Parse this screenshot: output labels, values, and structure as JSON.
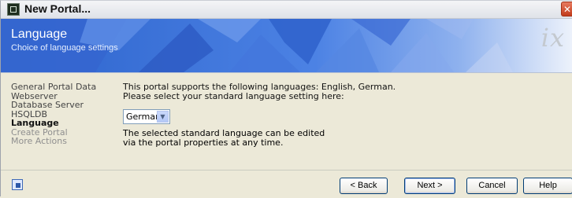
{
  "window": {
    "title": "New Portal...",
    "close_label": "✕"
  },
  "banner": {
    "title": "Language",
    "subtitle": "Choice of language settings",
    "logo": "ix"
  },
  "nav": {
    "items": [
      {
        "label": "General Portal Data",
        "state": "done"
      },
      {
        "label": "Webserver",
        "state": "done"
      },
      {
        "label": "Database Server",
        "state": "done"
      },
      {
        "label": "HSQLDB",
        "state": "done"
      },
      {
        "label": "Language",
        "state": "active"
      },
      {
        "label": "Create Portal",
        "state": "disabled"
      },
      {
        "label": "More Actions",
        "state": "disabled"
      }
    ]
  },
  "content": {
    "line1": "This portal supports the following languages: English, German.",
    "line2": "Please select your standard language setting here:",
    "language_select": {
      "value": "German"
    },
    "note1": "The selected standard language can be edited",
    "note2": "via the portal properties at any time."
  },
  "footer": {
    "back": "< Back",
    "next": "Next >",
    "cancel": "Cancel",
    "help": "Help"
  },
  "colors": {
    "banner_blue": "#3f6fd6",
    "dialog_bg": "#ece9d8",
    "close_red": "#d1492a"
  }
}
